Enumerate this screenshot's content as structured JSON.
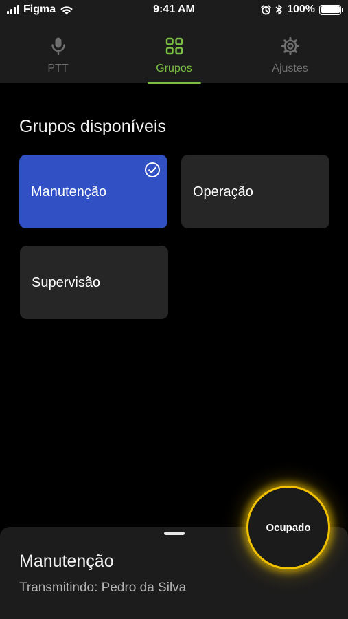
{
  "status_bar": {
    "carrier": "Figma",
    "time": "9:41 AM",
    "battery": "100%",
    "icons": [
      "signal-icon",
      "wifi-icon",
      "alarm-icon",
      "bluetooth-icon",
      "battery-icon"
    ]
  },
  "tabs": [
    {
      "label": "PTT",
      "icon": "microphone-icon",
      "active": false
    },
    {
      "label": "Grupos",
      "icon": "grid-icon",
      "active": true
    },
    {
      "label": "Ajustes",
      "icon": "gear-icon",
      "active": false
    }
  ],
  "section_title": "Grupos disponíveis",
  "groups": [
    {
      "label": "Manutenção",
      "selected": true
    },
    {
      "label": "Operação",
      "selected": false
    },
    {
      "label": "Supervisão",
      "selected": false
    }
  ],
  "bottom_sheet": {
    "title": "Manutenção",
    "subtitle": "Transmitindo: Pedro da Silva"
  },
  "ptt_button": {
    "label": "Ocupado",
    "state": "busy"
  },
  "colors": {
    "accent": "#7cc043",
    "selected_card": "#3050c4",
    "card": "#262626",
    "busy_glow": "#f2c200",
    "background": "#000000",
    "bar": "#1c1c1c"
  }
}
